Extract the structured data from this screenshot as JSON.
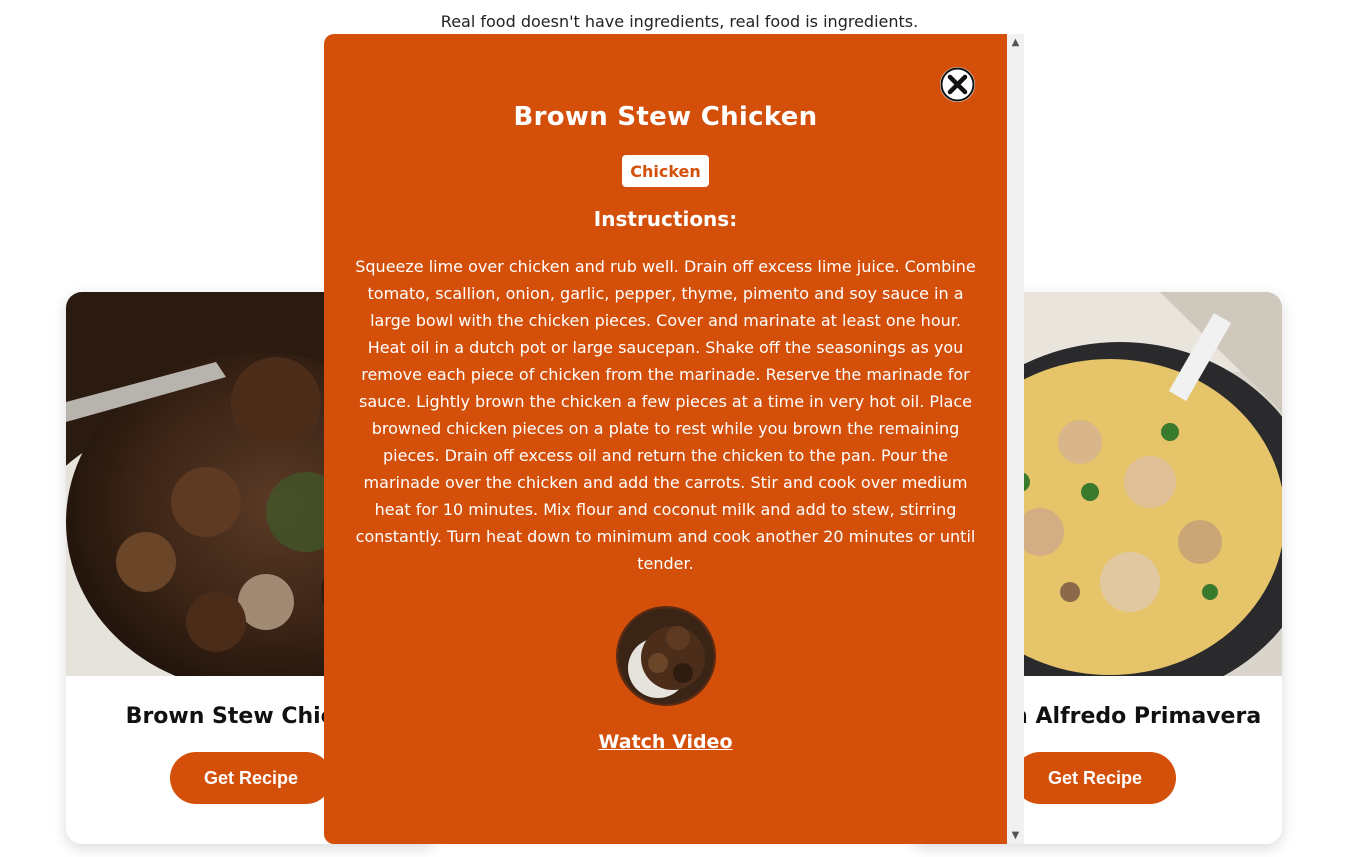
{
  "page": {
    "tagline": "Real food doesn't have ingredients, real food is ingredients."
  },
  "cards": [
    {
      "title": "Brown Stew Chicken",
      "button": "Get Recipe"
    },
    {
      "title": "Chicken Alfredo Primavera",
      "button": "Get Recipe"
    }
  ],
  "modal": {
    "title": "Brown Stew Chicken",
    "category": "Chicken",
    "instructions_heading": "Instructions:",
    "instructions": "Squeeze lime over chicken and rub well. Drain off excess lime juice. Combine tomato, scallion, onion, garlic, pepper, thyme, pimento and soy sauce in a large bowl with the chicken pieces. Cover and marinate at least one hour. Heat oil in a dutch pot or large saucepan. Shake off the seasonings as you remove each piece of chicken from the marinade. Reserve the marinade for sauce. Lightly brown the chicken a few pieces at a time in very hot oil. Place browned chicken pieces on a plate to rest while you brown the remaining pieces. Drain off excess oil and return the chicken to the pan. Pour the marinade over the chicken and add the carrots. Stir and cook over medium heat for 10 minutes. Mix flour and coconut milk and add to stew, stirring constantly. Turn heat down to minimum and cook another 20 minutes or until tender.",
    "video_link": "Watch Video",
    "close_icon": "close-icon"
  },
  "colors": {
    "accent": "#d4500a",
    "modal_bg": "#d4500a",
    "text_dark": "#111111"
  }
}
